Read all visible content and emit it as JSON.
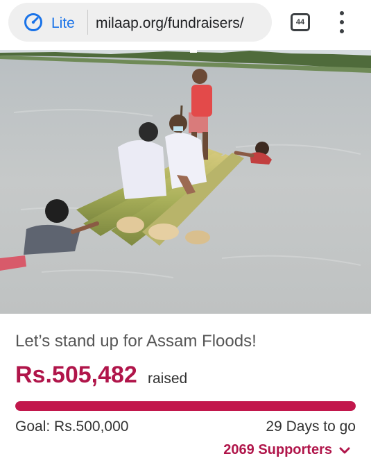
{
  "browser": {
    "mode_label": "Lite",
    "url": "milaap.org/fundraisers/",
    "tab_count": "44",
    "icons": {
      "mode": "speedometer-icon",
      "tabs": "tab-switcher-icon",
      "menu": "more-vert-icon"
    },
    "accent_color": "#1a73e8"
  },
  "campaign": {
    "title": "Let’s stand up for Assam Floods!",
    "raised_amount": "Rs.505,482",
    "raised_label": "raised",
    "progress_percent": 100,
    "goal": "Goal: Rs.500,000",
    "days_left": "29 Days to go",
    "supporters": "2069 Supporters",
    "brand_color": "#c2174c"
  }
}
